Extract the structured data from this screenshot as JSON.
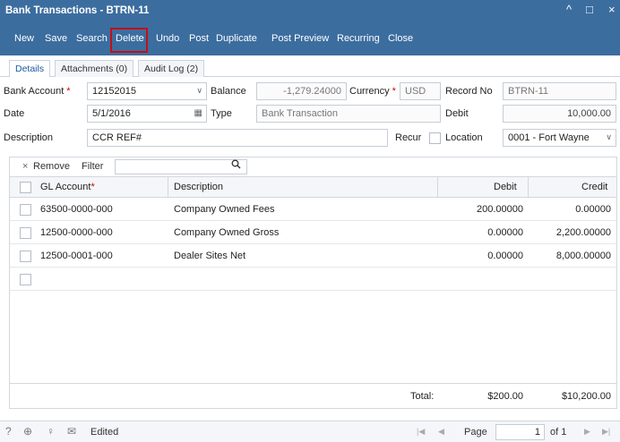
{
  "window": {
    "title": "Bank Transactions - BTRN-11",
    "minimize_icon": "^",
    "maximize_icon": "□",
    "close_icon": "×"
  },
  "toolbar": {
    "new": "New",
    "save": "Save",
    "search": "Search",
    "delete": "Delete",
    "undo": "Undo",
    "post": "Post",
    "duplicate": "Duplicate",
    "post_preview": "Post Preview",
    "recurring": "Recurring",
    "close": "Close",
    "highlight_color": "#c0101a"
  },
  "tabs": {
    "details": "Details",
    "attachments": "Attachments (0)",
    "audit_log": "Audit Log (2)"
  },
  "form": {
    "bank_account_label": "Bank Account",
    "bank_account_value": "12152015",
    "balance_label": "Balance",
    "balance_value": "-1,279.24000",
    "currency_label": "Currency",
    "currency_value": "USD",
    "record_no_label": "Record No",
    "record_no_value": "BTRN-11",
    "date_label": "Date",
    "date_value": "5/1/2016",
    "type_label": "Type",
    "type_value": "Bank Transaction",
    "debit_label": "Debit",
    "debit_value": "10,000.00",
    "description_label": "Description",
    "description_value": "CCR REF#",
    "recur_label": "Recur",
    "location_label": "Location",
    "location_value": "0001 - Fort Wayne",
    "required_mark": "*"
  },
  "grid_toolbar": {
    "remove": "Remove",
    "remove_icon": "×",
    "filter": "Filter",
    "search_icon": "🔍"
  },
  "grid": {
    "columns": {
      "gl_account": "GL Account",
      "description": "Description",
      "debit": "Debit",
      "credit": "Credit"
    },
    "rows": [
      {
        "gl_account": "63500-0000-000",
        "description": "Company Owned Fees",
        "debit": "200.00000",
        "credit": "0.00000"
      },
      {
        "gl_account": "12500-0000-000",
        "description": "Company Owned Gross",
        "debit": "0.00000",
        "credit": "2,200.00000"
      },
      {
        "gl_account": "12500-0001-000",
        "description": "Dealer Sites Net",
        "debit": "0.00000",
        "credit": "8,000.00000"
      }
    ],
    "total_label": "Total:",
    "total_debit": "$200.00",
    "total_credit": "$10,200.00"
  },
  "statusbar": {
    "help_icon": "?",
    "support_icon": "⊕",
    "idea_icon": "♀",
    "mail_icon": "✉",
    "status": "Edited",
    "page_label": "Page",
    "page_value": "1",
    "of_label": "of 1",
    "first_icon": "|◀",
    "prev_icon": "◀",
    "next_icon": "▶",
    "last_icon": "▶|"
  }
}
